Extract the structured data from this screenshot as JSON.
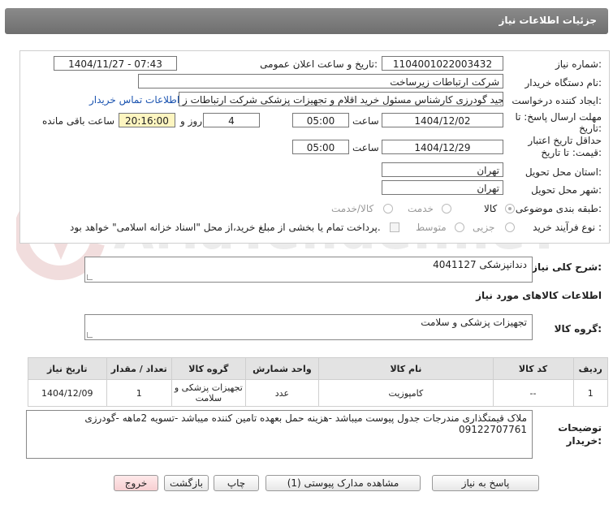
{
  "header": {
    "title": "جزئیات اطلاعات نیاز"
  },
  "form": {
    "need_number_label": "شماره نیاز:",
    "need_number": "1104001022003432",
    "announce_label": "تاریخ و ساعت اعلان عمومی:",
    "announce_value": "1404/11/27 - 07:43",
    "buyer_org_label": "نام دستگاه خریدار:",
    "buyer_org": "شرکت ارتباطات زیرساخت",
    "requester_label": "ایجاد کننده درخواست:",
    "requester": "مجید گودرزی کارشناس مسئول خرید اقلام و تجهیزات پزشکی شرکت ارتباطات ز",
    "contact_link": "اطلاعات تماس خریدار",
    "deadline_label_1": "مهلت ارسال پاسخ: تا",
    "deadline_label_2": "تاریخ:",
    "deadline_date": "1404/12/02",
    "time_label": "ساعت",
    "deadline_time": "05:00",
    "days_value": "4",
    "days_label": "روز و",
    "remaining_time": "20:16:00",
    "remaining_label": "ساعت باقی مانده",
    "validity_label_1": "حداقل تاریخ اعتبار",
    "validity_label_2": "قیمت: تا تاریخ:",
    "validity_date": "1404/12/29",
    "validity_time": "05:00",
    "province_label": "استان محل تحویل:",
    "province": "تهران",
    "city_label": "شهر محل تحویل:",
    "city": "تهران",
    "category_label": "طبقه بندی موضوعی:",
    "category_options": [
      "کالا",
      "خدمت",
      "کالا/خدمت"
    ],
    "category_selected": "کالا",
    "process_label": "نوع فرآیند خرید :",
    "process_options": [
      "جزیی",
      "متوسط"
    ],
    "payment_note": "پرداخت تمام یا بخشی از مبلغ خرید،از محل \"اسناد خزانه اسلامی\" خواهد بود."
  },
  "description": {
    "label": "شرح کلی نیاز:",
    "value": "دندانپزشکی 4041127"
  },
  "goods_info_title": "اطلاعات کالاهای مورد نیاز",
  "goods_group": {
    "label": "گروه کالا:",
    "value": "تجهیزات پزشکی و سلامت"
  },
  "table": {
    "headers": [
      "ردیف",
      "کد کالا",
      "نام کالا",
      "واحد شمارش",
      "گروه کالا",
      "تعداد / مقدار",
      "تاریخ نیاز"
    ],
    "rows": [
      [
        "1",
        "--",
        "کامپوزیت",
        "عدد",
        "تجهیزات پزشکی و سلامت",
        "1",
        "1404/12/09"
      ]
    ]
  },
  "buyer_notes": {
    "label_1": "توضیحات",
    "label_2": "خریدار:",
    "line_1": "ملاک قیمتگذاری مندرجات جدول پیوست میباشد -هزینه حمل بعهده تامین کننده میباشد -تسویه 2ماهه -گودرزی",
    "line_2": "09122707761"
  },
  "buttons": {
    "reply": "پاسخ به نیاز",
    "attachments": "مشاهده مدارک پیوستی (1)",
    "print": "چاپ",
    "back": "بازگشت",
    "exit": "خروج"
  },
  "watermark": "AriaTender.neT",
  "colors": {
    "header_bg": "#7a7a7a",
    "link": "#1a53b0",
    "remaining_bg": "#fdf5c0",
    "exit_btn": "#f7cfd2"
  }
}
